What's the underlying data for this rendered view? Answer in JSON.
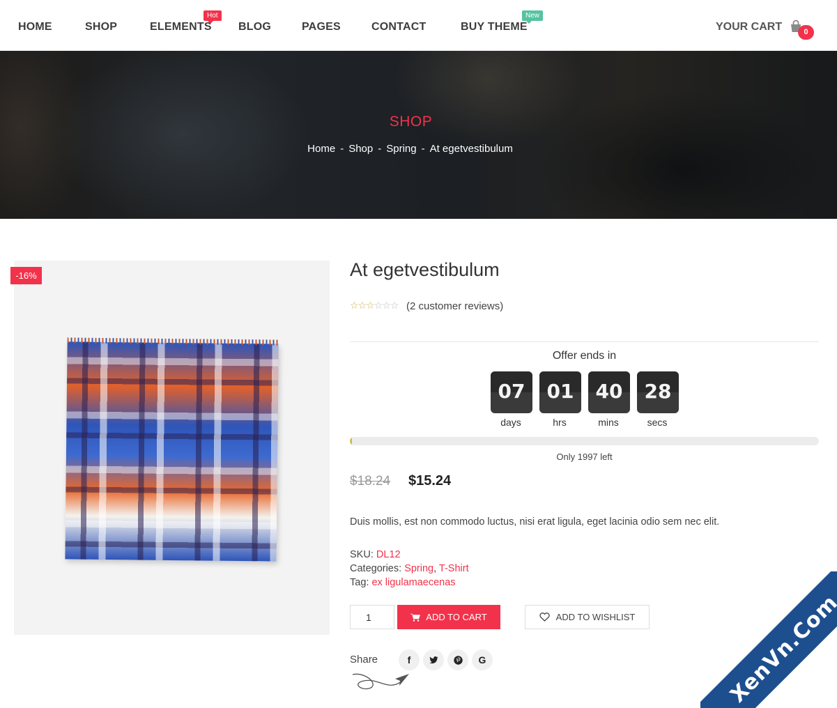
{
  "nav": {
    "items": [
      {
        "label": "HOME"
      },
      {
        "label": "SHOP"
      },
      {
        "label": "ELEMENTS"
      },
      {
        "label": "BLOG"
      },
      {
        "label": "PAGES"
      },
      {
        "label": "CONTACT"
      },
      {
        "label": "BUY THEME"
      }
    ],
    "badges": {
      "hot": "Hot",
      "new": "New"
    },
    "cart_label": "YOUR CART",
    "cart_count": "0"
  },
  "hero": {
    "title": "SHOP",
    "breadcrumb": [
      "Home",
      "Shop",
      "Spring",
      "At egetvestibulum"
    ],
    "separator": "-"
  },
  "product": {
    "sale_badge": "-16%",
    "title": "At egetvestibulum",
    "rating": {
      "stars_filled": 3,
      "stars_total": 6
    },
    "reviews": "(2 customer reviews)",
    "offer_label": "Offer ends in",
    "countdown": [
      {
        "value": "07",
        "unit": "days"
      },
      {
        "value": "01",
        "unit": "hrs"
      },
      {
        "value": "40",
        "unit": "mins"
      },
      {
        "value": "28",
        "unit": "secs"
      }
    ],
    "stock_progress": 0.005,
    "stock_text": "Only 1997 left",
    "old_price": "$18.24",
    "new_price": "$15.24",
    "description": "Duis mollis, est non commodo luctus, nisi erat ligula, eget lacinia odio sem nec elit.",
    "sku_label": "SKU:",
    "sku": "DL12",
    "categories_label": "Categories:",
    "categories": [
      "Spring",
      "T-Shirt"
    ],
    "tag_label": "Tag:",
    "tag": "ex ligulamaecenas",
    "quantity": "1",
    "add_to_cart": "ADD TO CART",
    "add_to_wishlist": "ADD TO WISHLIST",
    "share_label": "Share",
    "social": [
      {
        "icon": "facebook-icon",
        "glyph": "f"
      },
      {
        "icon": "twitter-icon",
        "glyph": "t"
      },
      {
        "icon": "pinterest-icon",
        "glyph": "p"
      },
      {
        "icon": "google-icon",
        "glyph": "G"
      }
    ]
  },
  "watermark": {
    "text": "XenVn.Com"
  },
  "colors": {
    "accent": "#f2324b",
    "badge_new": "#56c3a0",
    "countdown_bg": "#3a3a3a",
    "progress": "#d6b94a"
  }
}
